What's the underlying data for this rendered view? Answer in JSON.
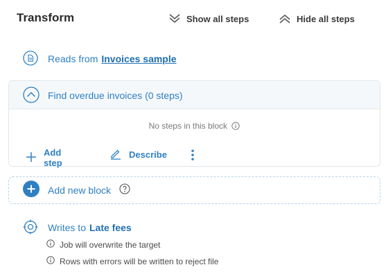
{
  "header": {
    "title": "Transform",
    "show_all_label": "Show all steps",
    "hide_all_label": "Hide all steps"
  },
  "source": {
    "prefix": "Reads from",
    "name": "Invoices sample"
  },
  "block": {
    "title": "Find overdue invoices (0 steps)",
    "empty_text": "No steps in this block",
    "add_step_label": "Add step",
    "describe_label": "Describe"
  },
  "add_block": {
    "label": "Add new block"
  },
  "target": {
    "prefix": "Writes to",
    "name": "Late fees",
    "notes": [
      "Job will overwrite the target",
      "Rows with errors will be written to reject file"
    ]
  },
  "colors": {
    "accent": "#2f80c2",
    "accent_dark": "#1f6fb0",
    "text": "#2b2b2b",
    "muted": "#7a7a7a"
  }
}
